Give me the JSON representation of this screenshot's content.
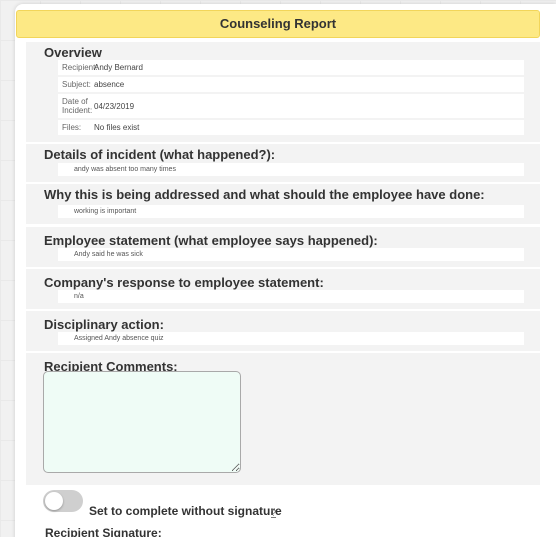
{
  "report": {
    "title": "Counseling Report"
  },
  "overview": {
    "heading": "Overview",
    "rows": [
      {
        "label": "Recipient:",
        "value": "Andy Bernard"
      },
      {
        "label": "Subject:",
        "value": "absence"
      },
      {
        "label": "Date of Incident:",
        "value": "04/23/2019"
      },
      {
        "label": "Files:",
        "value": "No files exist"
      }
    ]
  },
  "details": {
    "heading": "Details of incident (what happened?):",
    "text": "andy was absent too many times"
  },
  "why": {
    "heading": "Why this is being addressed and what should the employee have done:",
    "text": "working is important"
  },
  "statement": {
    "heading": "Employee statement (what employee says happened):",
    "text": "Andy said he was sick"
  },
  "response": {
    "heading": "Company's response to employee statement:",
    "text": "n/a"
  },
  "disciplinary": {
    "heading": "Disciplinary action:",
    "text": "Assigned Andy absence quiz"
  },
  "comments": {
    "heading": "Recipient Comments:",
    "value": ""
  },
  "complete_toggle": {
    "label": "Set to complete without signature",
    "help": "?",
    "state": "off"
  },
  "signature": {
    "heading": "Recipient Signature:"
  }
}
